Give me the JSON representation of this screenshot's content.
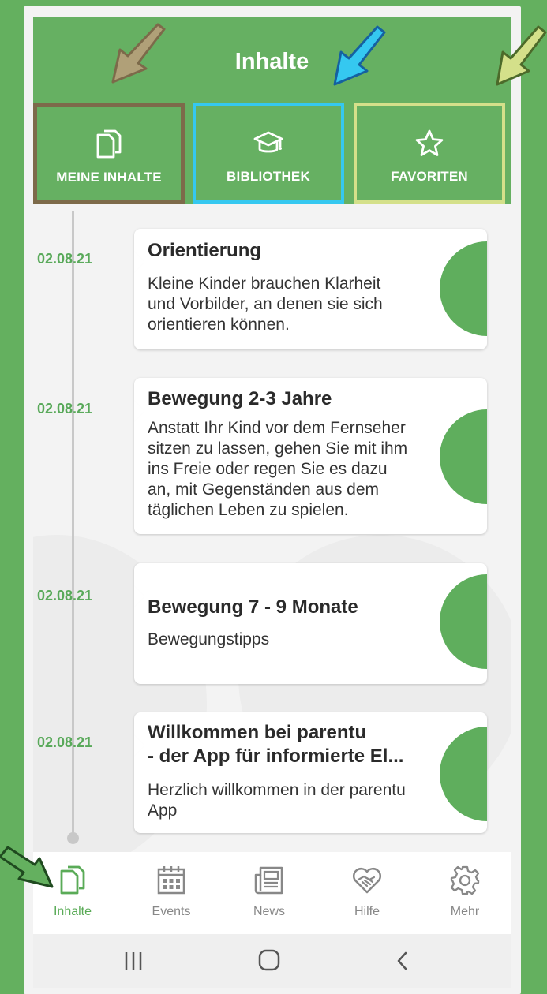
{
  "header": {
    "title": "Inhalte",
    "buttons": [
      {
        "label": "MEINE INHALTE",
        "icon": "documents-icon"
      },
      {
        "label": "BIBLIOTHEK",
        "icon": "graduation-cap-icon"
      },
      {
        "label": "FAVORITEN",
        "icon": "star-icon"
      }
    ]
  },
  "entries": [
    {
      "date": "02.08.21",
      "title": "Orientierung",
      "desc_lines": [
        "Kleine Kinder brauchen Klarheit",
        "und Vorbilder, an denen sie sich",
        "orientieren können."
      ]
    },
    {
      "date": "02.08.21",
      "title": "Bewegung 2-3 Jahre",
      "desc_lines": [
        "Anstatt Ihr Kind vor dem Fernseher",
        "sitzen zu lassen, gehen Sie mit ihm",
        "ins Freie oder regen Sie es dazu",
        "an, mit Gegenständen aus dem",
        "täglichen Leben zu spielen."
      ]
    },
    {
      "date": "02.08.21",
      "title": "Bewegung 7 - 9 Monate",
      "desc_lines": [
        "Bewegungstipps"
      ]
    },
    {
      "date": "02.08.21",
      "title_lines": [
        "Willkommen bei parentu",
        "- der App für informierte El..."
      ],
      "desc_lines": [
        "Herzlich willkommen in der parentu",
        "App"
      ]
    }
  ],
  "bottom_nav": [
    {
      "label": "Inhalte",
      "icon": "documents-icon",
      "active": true
    },
    {
      "label": "Events",
      "icon": "calendar-icon",
      "active": false
    },
    {
      "label": "News",
      "icon": "newspaper-icon",
      "active": false
    },
    {
      "label": "Hilfe",
      "icon": "handshake-heart-icon",
      "active": false
    },
    {
      "label": "Mehr",
      "icon": "gear-icon",
      "active": false
    }
  ],
  "colors": {
    "background": "#64b05f",
    "header": "#66b062",
    "accent": "#5aab57",
    "arrow_brown": "#b0a078",
    "arrow_blue": "#35c8f0",
    "arrow_yellow": "#d4e08a"
  }
}
